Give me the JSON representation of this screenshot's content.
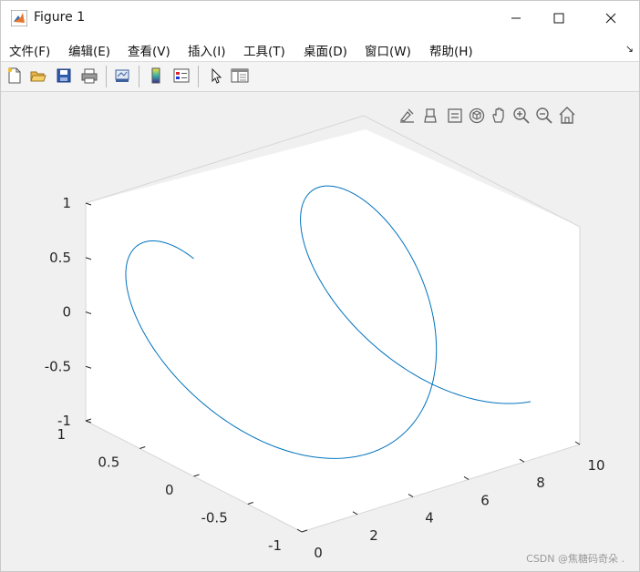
{
  "window": {
    "title": "Figure 1"
  },
  "menu": [
    "文件(F)",
    "编辑(E)",
    "查看(V)",
    "插入(I)",
    "工具(T)",
    "桌面(D)",
    "窗口(W)",
    "帮助(H)"
  ],
  "axes_toolbar": [
    "brush-icon",
    "eraser-icon",
    "data-tip-icon",
    "rotate-3d-icon",
    "pan-icon",
    "zoom-in-icon",
    "zoom-out-icon",
    "home-icon"
  ],
  "chart_data": {
    "type": "line3d",
    "title": "",
    "xlabel": "",
    "ylabel": "",
    "zlabel": "",
    "xlim": [
      0,
      10
    ],
    "ylim": [
      -1,
      1
    ],
    "zlim": [
      -1,
      1
    ],
    "x_ticks": [
      "0",
      "2",
      "4",
      "6",
      "8",
      "10"
    ],
    "y_ticks": [
      "-1",
      "-0.5",
      "0",
      "0.5",
      "1"
    ],
    "z_ticks": [
      "-1",
      "-0.5",
      "0",
      "0.5",
      "1"
    ],
    "series": [
      {
        "color": "#0072bd",
        "x": "t in [0, 10]",
        "y": "sin(t)",
        "z": "cos(t)"
      }
    ]
  },
  "watermark": "CSDN @焦糖码奇朵 ."
}
